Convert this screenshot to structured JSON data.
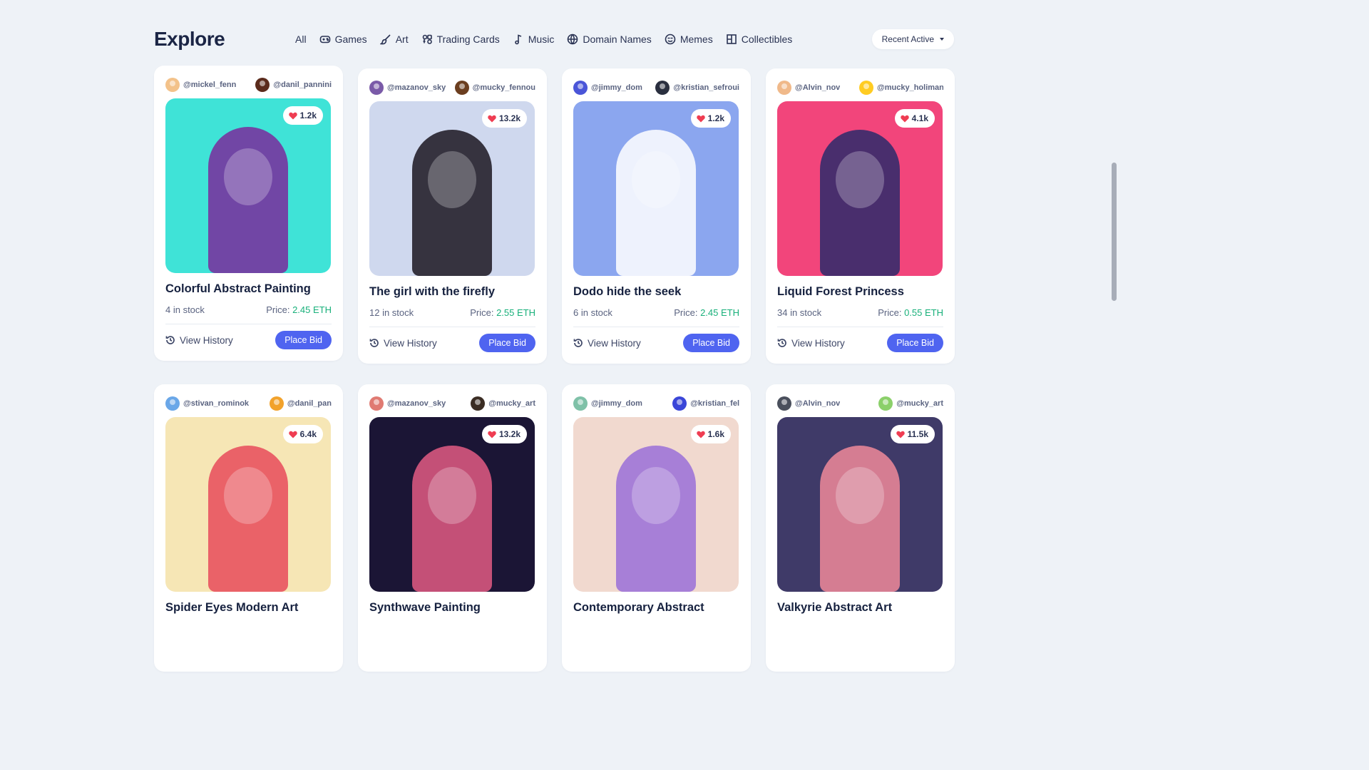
{
  "header": {
    "title": "Explore",
    "nav": [
      {
        "label": "All",
        "icon": ""
      },
      {
        "label": "Games",
        "icon": "gamepad-icon"
      },
      {
        "label": "Art",
        "icon": "brush-icon"
      },
      {
        "label": "Trading Cards",
        "icon": "cards-icon"
      },
      {
        "label": "Music",
        "icon": "music-note-icon"
      },
      {
        "label": "Domain Names",
        "icon": "globe-icon"
      },
      {
        "label": "Memes",
        "icon": "meme-face-icon"
      },
      {
        "label": "Collectibles",
        "icon": "grid-icon"
      }
    ],
    "sort_label": "Recent Active"
  },
  "labels": {
    "view_history": "View History",
    "place_bid": "Place Bid",
    "price_prefix": "Price: "
  },
  "cards": [
    {
      "owner1": "@mickel_fenn",
      "owner2": "@danil_pannini",
      "likes": "1.2k",
      "name": "Colorful Abstract Painting",
      "stock": "4 in stock",
      "price": "2.45 ETH",
      "bg": "#3fe3d7",
      "accent": "#7a2a9c",
      "av1": "#f3c28a",
      "av2": "#5b2b1c"
    },
    {
      "owner1": "@mazanov_sky",
      "owner2": "@mucky_fennou",
      "likes": "13.2k",
      "name": "The girl with the firefly",
      "stock": "12 in stock",
      "price": "2.55 ETH",
      "bg": "#cfd8ee",
      "accent": "#1b1620",
      "av1": "#7a5aa8",
      "av2": "#6b3e1f"
    },
    {
      "owner1": "@jimmy_dom",
      "owner2": "@kristian_sefroui",
      "likes": "1.2k",
      "name": "Dodo hide the seek",
      "stock": "6 in stock",
      "price": "2.45 ETH",
      "bg": "#8ba6ef",
      "accent": "#ffffff",
      "av1": "#4a55d8",
      "av2": "#2a2f3f"
    },
    {
      "owner1": "@Alvin_nov",
      "owner2": "@mucky_holiman",
      "likes": "4.1k",
      "name": "Liquid Forest Princess",
      "stock": "34 in stock",
      "price": "0.55 ETH",
      "bg": "#f2457b",
      "accent": "#2b2a6b",
      "av1": "#f0b98a",
      "av2": "#ffcc22"
    },
    {
      "owner1": "@stivan_rominok",
      "owner2": "@danil_pan",
      "likes": "6.4k",
      "name": "Spider Eyes Modern Art",
      "stock": "",
      "price": "",
      "bg": "#f6e6b5",
      "accent": "#e74a5a",
      "av1": "#6aa7e8",
      "av2": "#f2a22b"
    },
    {
      "owner1": "@mazanov_sky",
      "owner2": "@mucky_art",
      "likes": "13.2k",
      "name": "Synthwave Painting",
      "stock": "",
      "price": "",
      "bg": "#1b1535",
      "accent": "#e25a83",
      "av1": "#e07a72",
      "av2": "#3b2d24"
    },
    {
      "owner1": "@jimmy_dom",
      "owner2": "@kristian_fel",
      "likes": "1.6k",
      "name": "Contemporary Abstract",
      "stock": "",
      "price": "",
      "bg": "#f1d9cf",
      "accent": "#9a6fd8",
      "av1": "#7fc1a8",
      "av2": "#3a46d8"
    },
    {
      "owner1": "@Alvin_nov",
      "owner2": "@mucky_art",
      "likes": "11.5k",
      "name": "Valkyrie Abstract Art",
      "stock": "",
      "price": "",
      "bg": "#3f3a68",
      "accent": "#f08a9a",
      "av1": "#4a4f5c",
      "av2": "#8bd06a"
    }
  ]
}
